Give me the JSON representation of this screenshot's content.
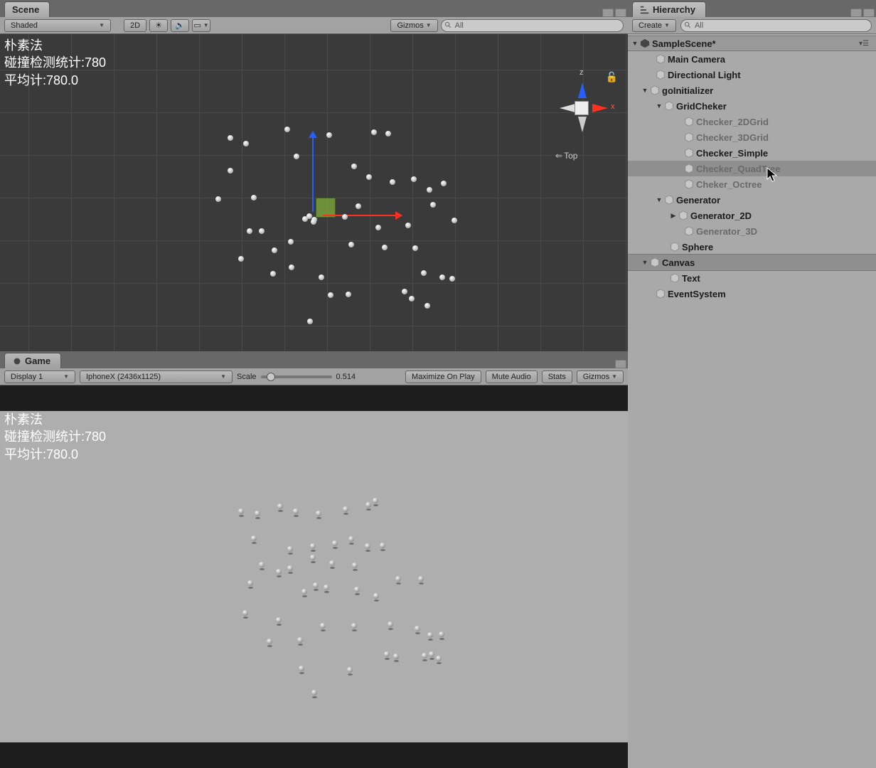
{
  "scene": {
    "tab": "Scene",
    "shading": "Shaded",
    "btn_2d": "2D",
    "gizmos": "Gizmos",
    "search_placeholder": "All",
    "overlay_line1": "朴素法",
    "overlay_line2": "碰撞检测统计:780",
    "overlay_line3": "平均计:780.0",
    "axis_z": "z",
    "axis_x": "x",
    "axis_top": "Top"
  },
  "game": {
    "tab": "Game",
    "display": "Display 1",
    "resolution": "IphoneX (2436x1125)",
    "scale_label": "Scale",
    "scale_value": "0.514",
    "maximize": "Maximize On Play",
    "mute": "Mute Audio",
    "stats": "Stats",
    "gizmos": "Gizmos",
    "overlay_line1": "朴素法",
    "overlay_line2": "碰撞检测统计:780",
    "overlay_line3": "平均计:780.0"
  },
  "hierarchy": {
    "tab": "Hierarchy",
    "create": "Create",
    "search_placeholder": "All",
    "scene_name": "SampleScene*",
    "items": {
      "main_camera": "Main Camera",
      "directional_light": "Directional Light",
      "go_initializer": "goInitializer",
      "grid_checker": "GridCheker",
      "checker_2dgrid": "Checker_2DGrid",
      "checker_3dgrid": "Checker_3DGrid",
      "checker_simple": "Checker_Simple",
      "checker_quadtree": "Checker_QuadTree",
      "cheker_octree": "Cheker_Octree",
      "generator": "Generator",
      "generator_2d": "Generator_2D",
      "generator_3d": "Generator_3D",
      "sphere": "Sphere",
      "canvas": "Canvas",
      "text": "Text",
      "event_system": "EventSystem"
    }
  }
}
